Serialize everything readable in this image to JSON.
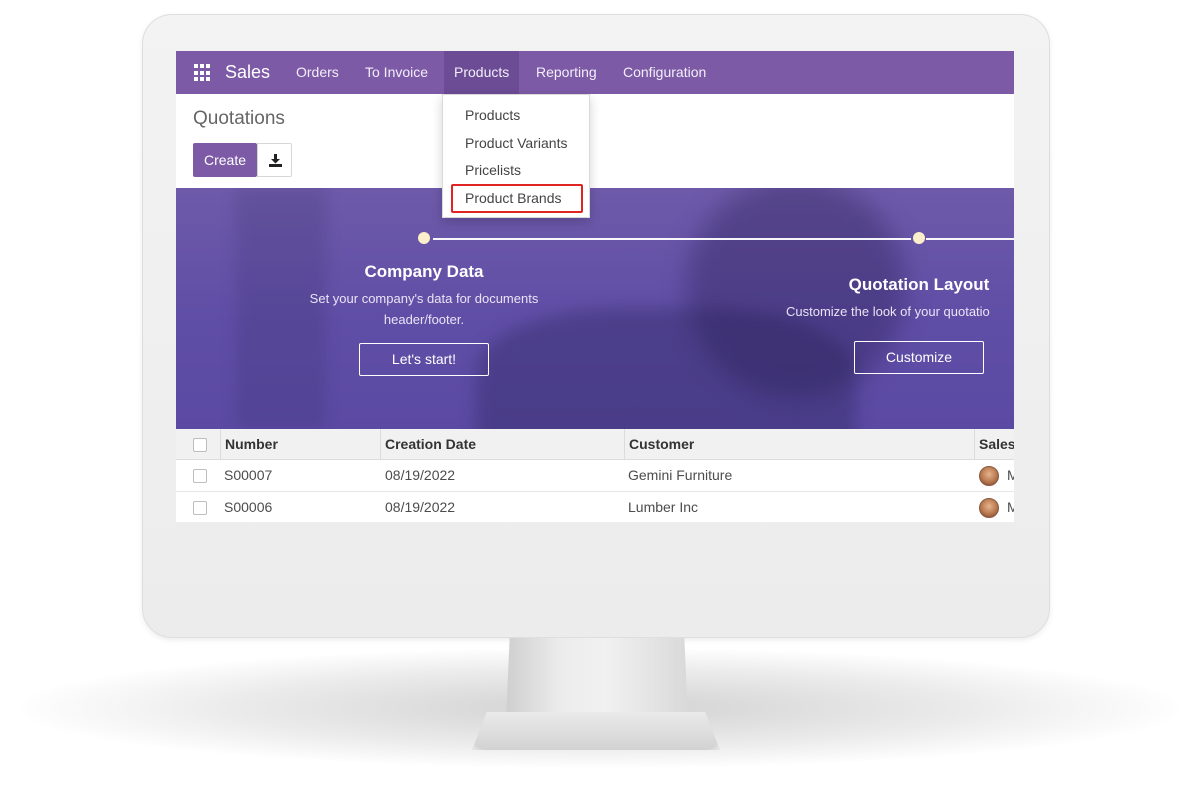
{
  "navbar": {
    "app_name": "Sales",
    "menu": [
      "Orders",
      "To Invoice",
      "Products",
      "Reporting",
      "Configuration"
    ],
    "active": "Products",
    "color": "#7c5aa6"
  },
  "products_dropdown": {
    "items": [
      "Products",
      "Product Variants",
      "Pricelists",
      "Product Brands"
    ],
    "highlighted": "Product Brands"
  },
  "page": {
    "breadcrumb": "Quotations",
    "create_label": "Create",
    "download_icon": "download-icon"
  },
  "onboarding": {
    "steps": [
      {
        "title": "Company Data",
        "description_line1": "Set your company's data for documents",
        "description_line2": "header/footer.",
        "button": "Let's start!"
      },
      {
        "title": "Quotation Layout",
        "description_line1": "Customize the look of your quotatio",
        "button": "Customize"
      }
    ]
  },
  "table": {
    "headers": [
      "Number",
      "Creation Date",
      "Customer",
      "Sales"
    ],
    "rows": [
      {
        "number": "S00007",
        "date": "08/19/2022",
        "customer": "Gemini Furniture",
        "salesperson_initial": "M"
      },
      {
        "number": "S00006",
        "date": "08/19/2022",
        "customer": "Lumber Inc",
        "salesperson_initial": "M"
      }
    ]
  }
}
